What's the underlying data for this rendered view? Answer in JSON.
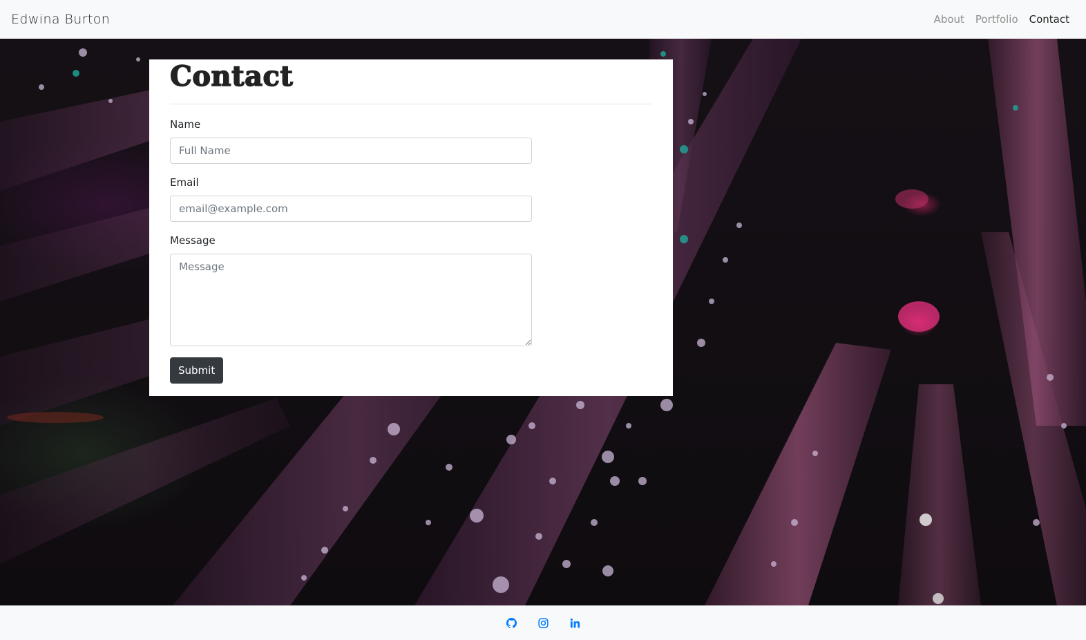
{
  "navbar": {
    "brand": "Edwina Burton",
    "links": [
      {
        "label": "About",
        "active": false
      },
      {
        "label": "Portfolio",
        "active": false
      },
      {
        "label": "Contact",
        "active": true
      }
    ]
  },
  "contact": {
    "title": "Contact",
    "fields": {
      "name": {
        "label": "Name",
        "placeholder": "Full Name",
        "value": ""
      },
      "email": {
        "label": "Email",
        "placeholder": "email@example.com",
        "value": ""
      },
      "message": {
        "label": "Message",
        "placeholder": "Message",
        "value": ""
      }
    },
    "submit_label": "Submit"
  },
  "footer": {
    "icons": [
      "github-icon",
      "instagram-icon",
      "linkedin-icon"
    ],
    "icon_color": "#007bff"
  },
  "colors": {
    "navbar_bg": "#f8f9fa",
    "button_bg": "#343a40",
    "accent": "#007bff",
    "hero_tone": "#4a2a44"
  }
}
